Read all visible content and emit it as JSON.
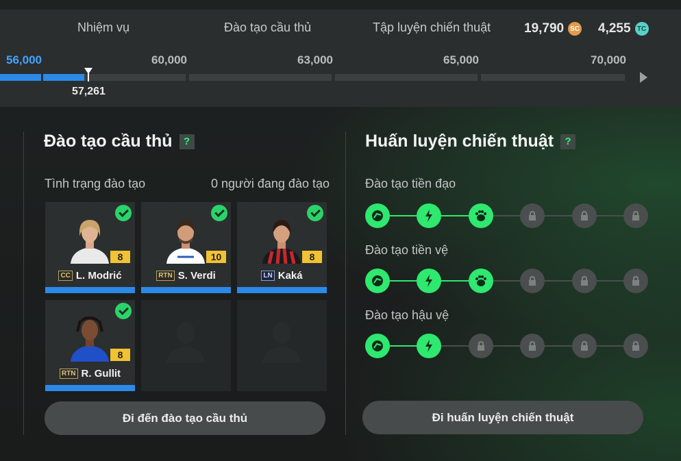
{
  "tabs": [
    "Nhiệm vụ",
    "Đào tạo cầu thủ",
    "Tập luyện chiến thuật"
  ],
  "currency": [
    {
      "amount": "19,790",
      "icon": "sc-coin-icon",
      "label": "SC"
    },
    {
      "amount": "4,255",
      "icon": "tc-coin-icon",
      "label": "TC"
    }
  ],
  "progress": {
    "milestones": [
      "56,000",
      "60,000",
      "63,000",
      "65,000",
      "70,000"
    ],
    "current": "57,261",
    "current_value": 57261
  },
  "player_training": {
    "title": "Đào tạo cầu thủ",
    "help": "?",
    "status_label": "Tình trạng đào tạo",
    "status_value": "0 người đang đào tạo",
    "players": [
      {
        "name": "L. Modrić",
        "position": "CC",
        "rating": "8",
        "done": true
      },
      {
        "name": "S. Verdi",
        "position": "RTN",
        "rating": "10",
        "done": true
      },
      {
        "name": "Kaká",
        "position": "LN",
        "rating": "8",
        "done": true
      },
      {
        "name": "R. Gullit",
        "position": "RTN",
        "rating": "8",
        "done": true
      }
    ],
    "button": "Đi đến đào tạo cầu thủ"
  },
  "tactical_training": {
    "title": "Huấn luyện chiến thuật",
    "help": "?",
    "rows": [
      {
        "label": "Đào tạo tiền đạo",
        "unlocked": 3,
        "total": 6
      },
      {
        "label": "Đào tạo tiền vệ",
        "unlocked": 3,
        "total": 6
      },
      {
        "label": "Đào tạo hậu vệ",
        "unlocked": 2,
        "total": 6
      }
    ],
    "button": "Đi huấn luyện chiến thuật"
  },
  "colors": {
    "accent": "#2ee86f",
    "progress": "#2b8ae8",
    "rating": "#f1c232"
  }
}
